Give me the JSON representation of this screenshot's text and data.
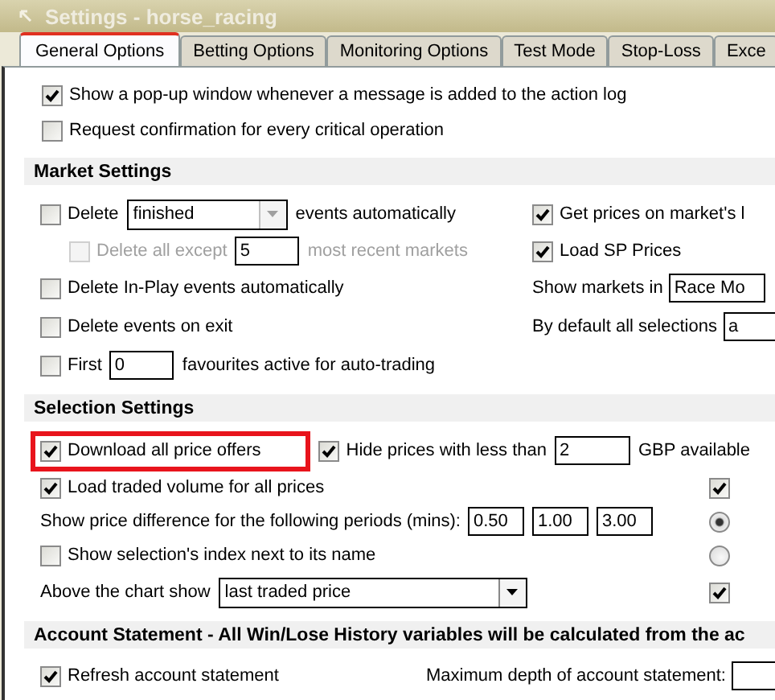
{
  "window": {
    "title": "Settings - horse_racing"
  },
  "tabs": [
    {
      "label": "General Options",
      "selected": true
    },
    {
      "label": "Betting Options",
      "selected": false
    },
    {
      "label": "Monitoring Options",
      "selected": false
    },
    {
      "label": "Test Mode",
      "selected": false
    },
    {
      "label": "Stop-Loss",
      "selected": false
    },
    {
      "label": "Exce",
      "selected": false
    }
  ],
  "general": [
    {
      "label": "Show a pop-up window whenever a message is added to the action log",
      "checked": true
    },
    {
      "label": "Request confirmation for every critical operation",
      "checked": false
    }
  ],
  "sections": [
    {
      "title": "Market Settings",
      "rows": [
        {
          "left": [
            {
              "kind": "checkbox",
              "label": "Delete",
              "checked": false
            },
            {
              "kind": "dropdown",
              "value": "finished",
              "disabled": true
            },
            {
              "kind": "text",
              "text": "events automatically"
            }
          ],
          "right": [
            {
              "kind": "checkbox",
              "label": "Get prices on market's l",
              "checked": true
            }
          ]
        },
        {
          "indent": true,
          "disabled": true,
          "left": [
            {
              "kind": "checkbox",
              "label": "Delete all except",
              "checked": false
            },
            {
              "kind": "field",
              "value": "5"
            },
            {
              "kind": "text",
              "text": "most recent markets"
            }
          ],
          "right": [
            {
              "kind": "checkbox",
              "label": "Load SP Prices",
              "checked": true
            }
          ]
        },
        {
          "left": [
            {
              "kind": "checkbox",
              "label": "Delete In-Play events automatically",
              "checked": false
            }
          ],
          "right": [
            {
              "kind": "text",
              "text": "Show markets in"
            },
            {
              "kind": "field",
              "value": "Race Mo"
            }
          ]
        },
        {
          "left": [
            {
              "kind": "checkbox",
              "label": "Delete events on exit",
              "checked": false
            }
          ],
          "right": [
            {
              "kind": "text",
              "text": "By default all selections"
            },
            {
              "kind": "field",
              "value": "a"
            }
          ]
        },
        {
          "left": [
            {
              "kind": "checkbox",
              "label": "First",
              "checked": false
            },
            {
              "kind": "field",
              "value": "0"
            },
            {
              "kind": "text",
              "text": "favourites active for auto-trading"
            }
          ]
        }
      ]
    },
    {
      "title": "Selection Settings",
      "rows": [
        {
          "left": [
            {
              "kind": "checkbox",
              "label": "Download all price offers",
              "checked": true,
              "highlighted": true
            },
            {
              "kind": "checkbox",
              "label": "Hide prices with less than",
              "checked": true
            },
            {
              "kind": "field",
              "value": "2"
            },
            {
              "kind": "text",
              "text": "GBP available"
            }
          ]
        },
        {
          "left": [
            {
              "kind": "checkbox",
              "label": "Load traded volume for all prices",
              "checked": true
            }
          ],
          "right": [
            {
              "kind": "checkbox",
              "checked": true
            }
          ]
        },
        {
          "left": [
            {
              "kind": "text",
              "text": "Show price difference for the following periods (mins):"
            },
            {
              "kind": "field",
              "value": "0.50"
            },
            {
              "kind": "field",
              "value": "1.00"
            },
            {
              "kind": "field",
              "value": "3.00"
            }
          ],
          "right": [
            {
              "kind": "radio",
              "selected": true
            }
          ]
        },
        {
          "left": [
            {
              "kind": "checkbox",
              "label": "Show selection's index next to its name",
              "checked": false
            }
          ],
          "right": [
            {
              "kind": "radio",
              "selected": false
            }
          ]
        },
        {
          "left": [
            {
              "kind": "text",
              "text": "Above the chart show"
            },
            {
              "kind": "dropdown",
              "value": "last traded price",
              "disabled": false
            }
          ],
          "right": [
            {
              "kind": "checkbox",
              "checked": true
            }
          ]
        }
      ]
    },
    {
      "title": "Account Statement - All Win/Lose History variables will be calculated from the ac",
      "rows": [
        {
          "left": [
            {
              "kind": "checkbox",
              "label": "Refresh account statement",
              "checked": true
            }
          ],
          "right": [
            {
              "kind": "text",
              "text": "Maximum depth of account statement:"
            },
            {
              "kind": "field"
            }
          ]
        }
      ]
    }
  ]
}
